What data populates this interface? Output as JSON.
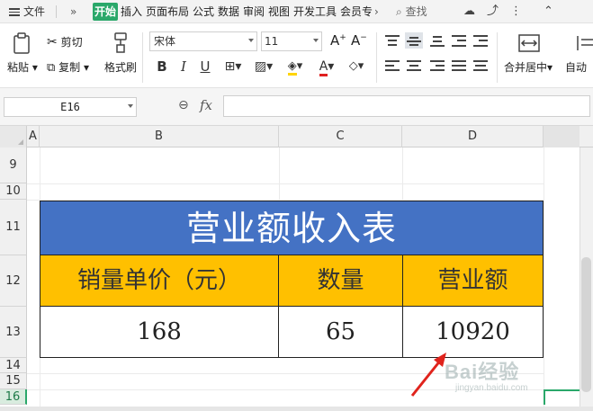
{
  "menubar": {
    "file": "文件",
    "more": "»",
    "tabs": [
      "开始",
      "插入",
      "页面布局",
      "公式",
      "数据",
      "审阅",
      "视图",
      "开发工具",
      "会员专"
    ],
    "active_tab": "开始",
    "search": "查找",
    "active_color": "#2aa86a"
  },
  "ribbon": {
    "paste": "粘贴",
    "cut": "剪切",
    "copy": "复制",
    "format_painter": "格式刷",
    "font_name": "宋体",
    "font_size": "11",
    "merge_center": "合并居中",
    "auto_wrap": "自动"
  },
  "formula_bar": {
    "cell_ref": "E16",
    "fx": "fx",
    "formula": ""
  },
  "grid": {
    "columns": [
      "A",
      "B",
      "C",
      "D"
    ],
    "rows": [
      "9",
      "10",
      "11",
      "12",
      "13",
      "14",
      "15",
      "16"
    ],
    "selected_row": "16"
  },
  "table": {
    "title": "营业额收入表",
    "headers": [
      "销量单价（元）",
      "数量",
      "营业额"
    ],
    "values": [
      "168",
      "65",
      "10920"
    ],
    "title_bg": "#4472c4",
    "header_bg": "#ffc000"
  },
  "watermark": {
    "logo": "Bai经验",
    "url": "jingyan.baidu.com"
  }
}
